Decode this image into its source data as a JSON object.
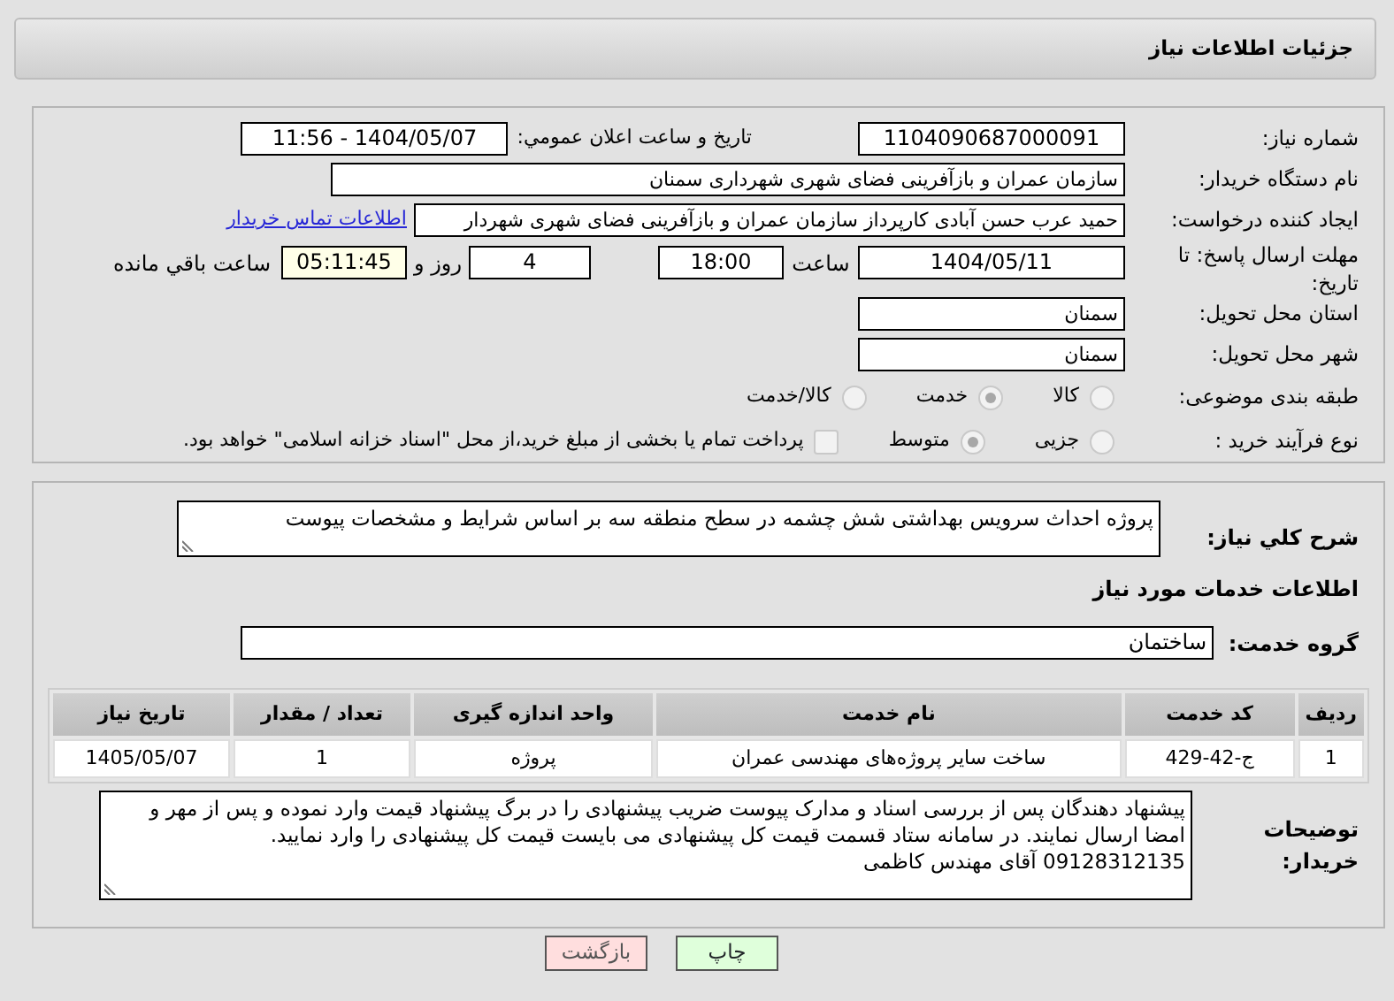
{
  "header": {
    "title": "جزئیات اطلاعات نیاز"
  },
  "details": {
    "need_number": {
      "label": "شماره نیاز:",
      "value": "1104090687000091"
    },
    "announce": {
      "label": "تاریخ و ساعت اعلان عمومي:",
      "value": "1404/05/07 - 11:56"
    },
    "buyer_org": {
      "label": "نام دستگاه خریدار:",
      "value": "سازمان عمران و بازآفرینی فضای شهری شهرداری سمنان"
    },
    "requester": {
      "label": "ایجاد کننده درخواست:",
      "value": "حمید عرب حسن آبادی کارپرداز سازمان عمران و بازآفرینی فضای شهری شهردار",
      "link": "اطلاعات تماس خریدار"
    },
    "deadline": {
      "label": "مهلت ارسال پاسخ: تا تاریخ:",
      "date": "1404/05/11",
      "time_label": "ساعت",
      "time": "18:00",
      "days": "4",
      "days_label": "روز و",
      "remaining": "05:11:45",
      "remaining_label": "ساعت باقي مانده"
    },
    "province": {
      "label": "استان محل تحویل:",
      "value": "سمنان"
    },
    "city": {
      "label": "شهر محل تحویل:",
      "value": "سمنان"
    },
    "category": {
      "label": "طبقه بندی موضوعی:",
      "options": [
        {
          "label": "کالا",
          "selected": false
        },
        {
          "label": "خدمت",
          "selected": true
        },
        {
          "label": "کالا/خدمت",
          "selected": false
        }
      ]
    },
    "process": {
      "label": "نوع فرآیند خرید :",
      "options": [
        {
          "label": "جزیی",
          "selected": false
        },
        {
          "label": "متوسط",
          "selected": true
        }
      ],
      "payment": {
        "checked": false,
        "label": "پرداخت تمام یا بخشی از مبلغ خرید،از محل \"اسناد خزانه اسلامی\" خواهد بود."
      }
    }
  },
  "summary": {
    "label": "شرح کلي نیاز:",
    "value": "پروژه احداث سرویس بهداشتی شش چشمه در سطح منطقه سه بر اساس شرایط و مشخصات پیوست"
  },
  "services_title": "اطلاعات خدمات مورد نیاز",
  "service_group": {
    "label": "گروه خدمت:",
    "value": "ساختمان"
  },
  "table": {
    "columns": [
      "ردیف",
      "کد خدمت",
      "نام خدمت",
      "واحد اندازه گیری",
      "تعداد / مقدار",
      "تاریخ نیاز"
    ],
    "rows": [
      [
        "1",
        "ج-42-429",
        "ساخت سایر پروژه‌های مهندسی عمران",
        "پروژه",
        "1",
        "1405/05/07"
      ]
    ]
  },
  "buyer_notes": {
    "label": "توضیحات خریدار:",
    "value": "پیشنهاد دهندگان پس از بررسی اسناد و مدارک پیوست ضریب پیشنهادی را در برگ پیشنهاد قیمت وارد نموده و پس از مهر و امضا ارسال نمایند. در سامانه ستاد قسمت قیمت کل پیشنهادی می بایست قیمت کل پیشنهادی را وارد نمایید.\n09128312135 آقای مهندس کاظمی"
  },
  "buttons": [
    {
      "kind": "print",
      "label": "چاپ"
    },
    {
      "kind": "back",
      "label": "بازگشت"
    }
  ]
}
